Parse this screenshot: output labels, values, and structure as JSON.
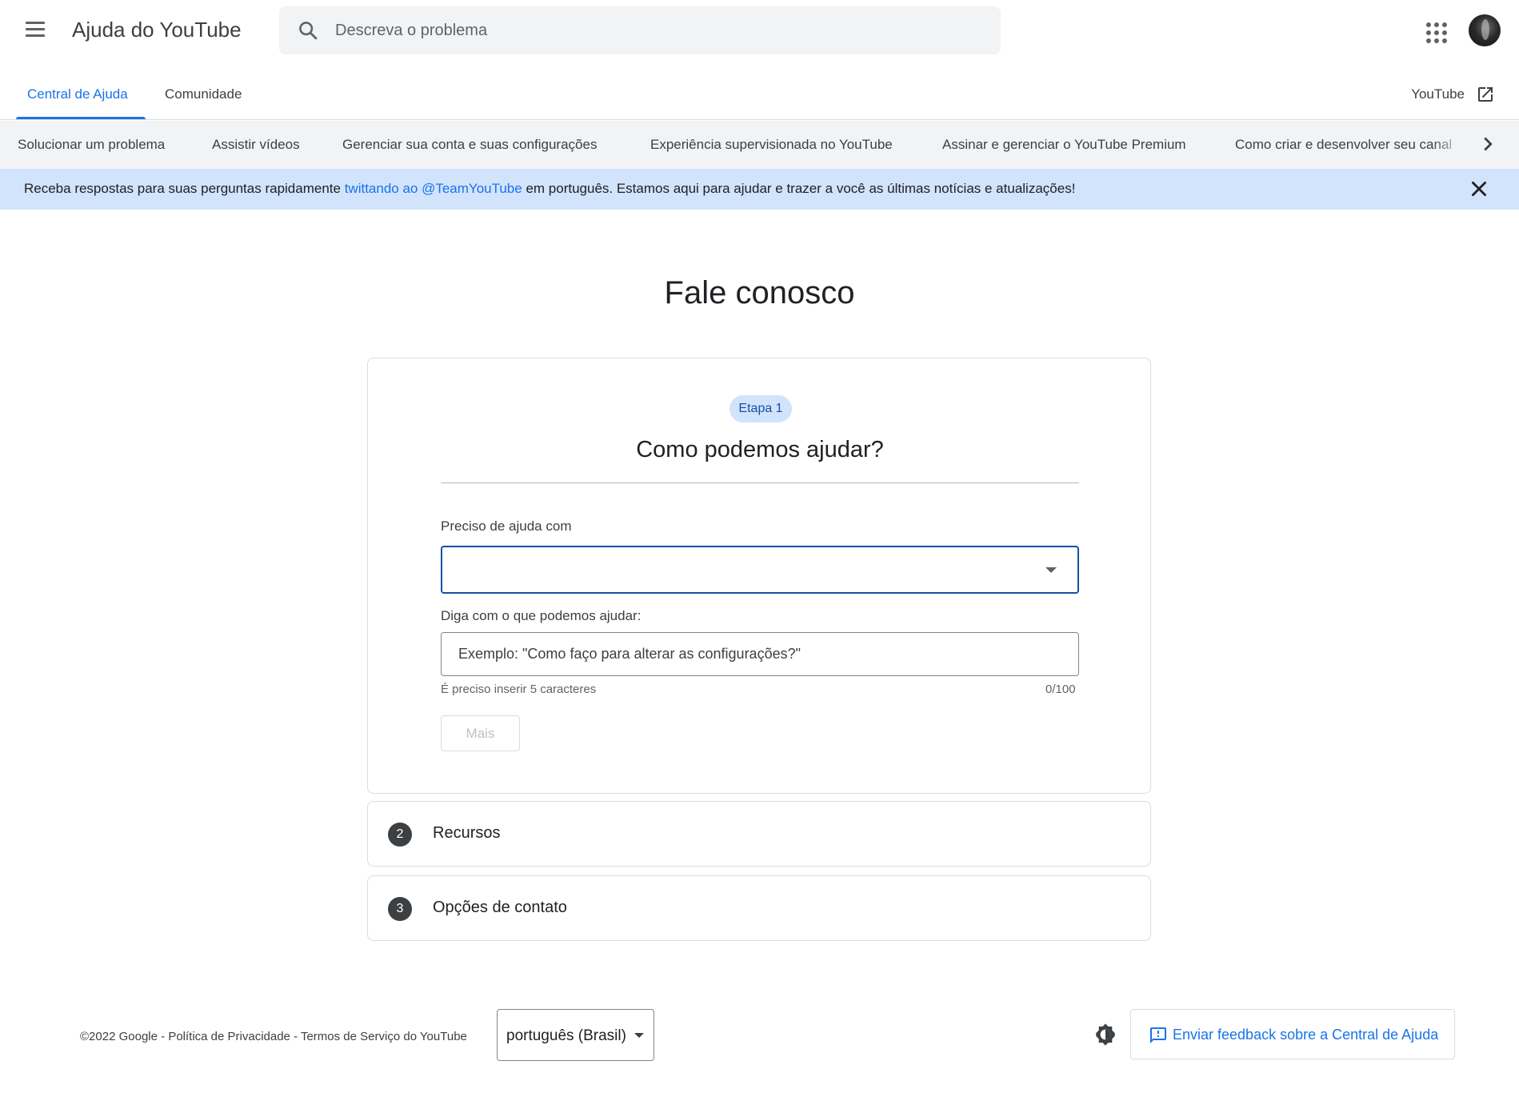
{
  "header": {
    "app_title": "Ajuda do YouTube",
    "search_placeholder": "Descreva o problema"
  },
  "tabs": {
    "help_center": "Central de Ajuda",
    "community": "Comunidade",
    "youtube_link": "YouTube"
  },
  "categories": [
    "Solucionar um problema",
    "Assistir vídeos",
    "Gerenciar sua conta e suas configurações",
    "Experiência supervisionada no YouTube",
    "Assinar e gerenciar o YouTube Premium",
    "Como criar e desenvolver seu canal"
  ],
  "banner": {
    "text_before": "Receba respostas para suas perguntas rapidamente ",
    "link_text": "twittando ao @TeamYouTube",
    "text_after": " em português. Estamos aqui para ajudar e trazer a você as últimas notícias e atualizações!"
  },
  "main": {
    "title": "Fale conosco",
    "step1": {
      "chip": "Etapa 1",
      "title": "Como podemos ajudar?",
      "select_label": "Preciso de ajuda com",
      "select_value": "",
      "input_label": "Diga com o que podemos ajudar:",
      "input_placeholder": "Exemplo: \"Como faço para alterar as configurações?\"",
      "input_value": "",
      "hint": "É preciso inserir 5 caracteres",
      "counter": "0/100",
      "more_button": "Mais"
    },
    "step2": {
      "number": "2",
      "label": "Recursos"
    },
    "step3": {
      "number": "3",
      "label": "Opções de contato"
    }
  },
  "footer": {
    "copyright": "©2022 Google",
    "privacy": "Política de Privacidade",
    "terms": "Termos de Serviço do YouTube",
    "separator": " - ",
    "language": "português (Brasil)",
    "feedback_label": "Enviar feedback sobre a Central de Ajuda"
  },
  "colors": {
    "accent": "#1a73e8",
    "banner_bg": "#d2e3fc",
    "category_bg": "#f1f3f4"
  },
  "icons": {
    "menu": "menu-icon",
    "search": "search-icon",
    "apps": "apps-grid-icon",
    "external": "open-in-new-icon",
    "next": "chevron-right-icon",
    "close": "close-icon",
    "dropdown": "caret-down-icon",
    "theme": "brightness-icon",
    "feedback": "feedback-icon"
  }
}
